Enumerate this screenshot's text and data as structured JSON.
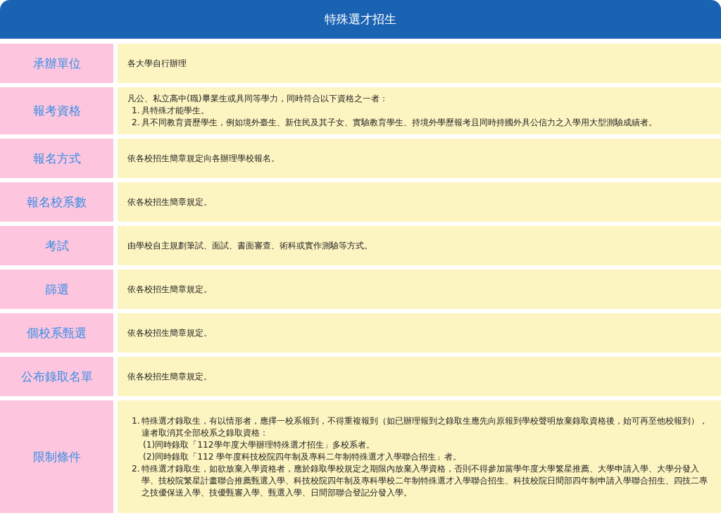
{
  "title": "特殊選才招生",
  "rows": [
    {
      "label": "承辦單位",
      "content": [
        {
          "kind": "para",
          "text": "各大學自行辦理"
        }
      ]
    },
    {
      "label": "報考資格",
      "content": [
        {
          "kind": "para",
          "text": "凡公、私立高中(職)畢業生或具同等學力，同時符合以下資格之一者："
        },
        {
          "kind": "list",
          "items": [
            {
              "marker": "1.",
              "text": "具特殊才能學生。"
            },
            {
              "marker": "2.",
              "text": "具不同教育資歷學生，例如境外臺生、新住民及其子女、實驗教育學生、持境外學歷報考且同時持國外具公信力之入學用大型測驗成績者。"
            }
          ]
        }
      ]
    },
    {
      "label": "報名方式",
      "content": [
        {
          "kind": "para",
          "text": "依各校招生簡章規定向各辦理學校報名。"
        }
      ]
    },
    {
      "label": "報名校系數",
      "content": [
        {
          "kind": "para",
          "text": "依各校招生簡章規定。"
        }
      ]
    },
    {
      "label": "考試",
      "content": [
        {
          "kind": "para",
          "text": "由學校自主規劃筆試、面試、書面審查、術科或實作測驗等方式。"
        }
      ]
    },
    {
      "label": "篩選",
      "content": [
        {
          "kind": "para",
          "text": "依各校招生簡章規定。"
        }
      ]
    },
    {
      "label": "個校系甄選",
      "content": [
        {
          "kind": "para",
          "text": "依各校招生簡章規定。"
        }
      ]
    },
    {
      "label": "公布錄取名單",
      "content": [
        {
          "kind": "para",
          "text": "依各校招生簡章規定。"
        }
      ]
    },
    {
      "label": "限制條件",
      "content": [
        {
          "kind": "list",
          "items": [
            {
              "marker": "1.",
              "text": "特殊選才錄取生，有以情形者，應擇一校系報到，不得重複報到（如已辦理報到之錄取生應先向原報到學校聲明放棄錄取資格後，始可再至他校報到），違者取消其全部校系之錄取資格：",
              "children": [
                "(1)同時錄取「112學年度大學辦理特殊選才招生」多校系者。",
                "(2)同時錄取「112 學年度科技校院四年制及專科二年制特殊選才入學聯合招生」者。"
              ]
            },
            {
              "marker": "2.",
              "text": "特殊選才錄取生，如欲放棄入學資格者，應於錄取學校規定之期限內放棄入學資格，否則不得參加當學年度大學繁星推薦、大學申請入學、大學分發入學、技校院繁星計畫聯合推薦甄選入學、科技校院四年制及專科學校二年制特殊選才入學聯合招生、科技校院日間部四年制申請入學聯合招生、四技二專之技優保送入學、技優甄審入學、甄選入學、日間部聯合登記分發入學。"
            }
          ]
        }
      ]
    }
  ]
}
